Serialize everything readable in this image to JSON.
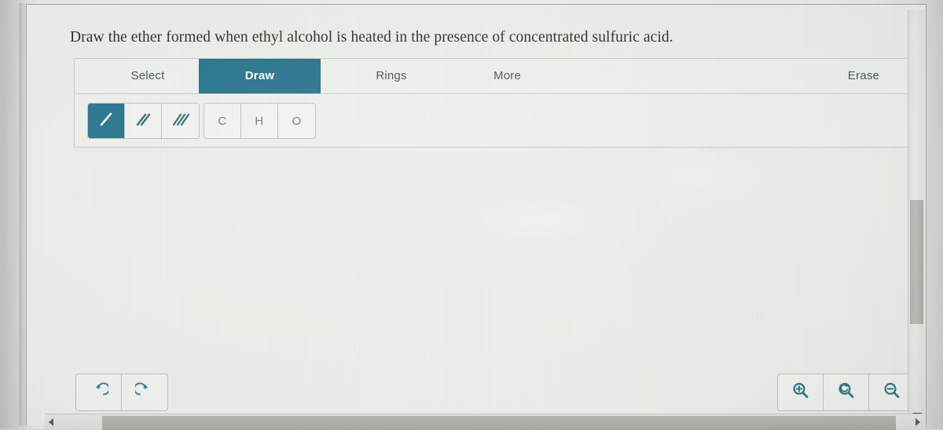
{
  "prompt": {
    "text": "Draw the ether formed when ethyl alcohol is heated in the presence of concentrated sulfuric acid."
  },
  "colors": {
    "accent_teal": "#166b85",
    "panel_border": "#c6cac5",
    "button_border": "#b9bfba",
    "canvas_bg": "#eceee9",
    "icon_teal": "#2e7f8f",
    "atom_text": "#5d7077",
    "tab_text": "#3c4a4f",
    "prompt_text": "#1d211f",
    "scrollbar_thumb": "#a9aea8"
  },
  "toolbar": {
    "tabs": [
      {
        "id": "select",
        "label": "Select",
        "active": false
      },
      {
        "id": "draw",
        "label": "Draw",
        "active": true
      },
      {
        "id": "rings",
        "label": "Rings",
        "active": false
      },
      {
        "id": "more",
        "label": "More",
        "active": false
      }
    ],
    "erase_label": "Erase",
    "bond_tools": [
      {
        "id": "single-bond",
        "icon": "single-bond-icon",
        "label": "Single bond",
        "active": true
      },
      {
        "id": "double-bond",
        "icon": "double-bond-icon",
        "label": "Double bond",
        "active": false
      },
      {
        "id": "triple-bond",
        "icon": "triple-bond-icon",
        "label": "Triple bond",
        "active": false
      }
    ],
    "atom_tools": [
      {
        "id": "atom-c",
        "label": "C",
        "active": false
      },
      {
        "id": "atom-h",
        "label": "H",
        "active": false
      },
      {
        "id": "atom-o",
        "label": "O",
        "active": false
      }
    ]
  },
  "history_controls": [
    {
      "id": "undo",
      "icon": "undo-icon",
      "label": "Undo"
    },
    {
      "id": "redo",
      "icon": "redo-icon",
      "label": "Redo"
    }
  ],
  "zoom_controls": [
    {
      "id": "zoom-in",
      "icon": "zoom-in-icon",
      "label": "Zoom in"
    },
    {
      "id": "zoom-reset",
      "icon": "zoom-reset-icon",
      "label": "Reset zoom"
    },
    {
      "id": "zoom-out",
      "icon": "zoom-out-icon",
      "label": "Zoom out"
    }
  ],
  "canvas": {
    "content": ""
  },
  "scrollbars": {
    "vertical": {
      "thumb_top_pct": 45,
      "thumb_height_pct": 30
    },
    "horizontal": {
      "thumb_left_pct": 7,
      "thumb_width_pct": 90
    }
  }
}
